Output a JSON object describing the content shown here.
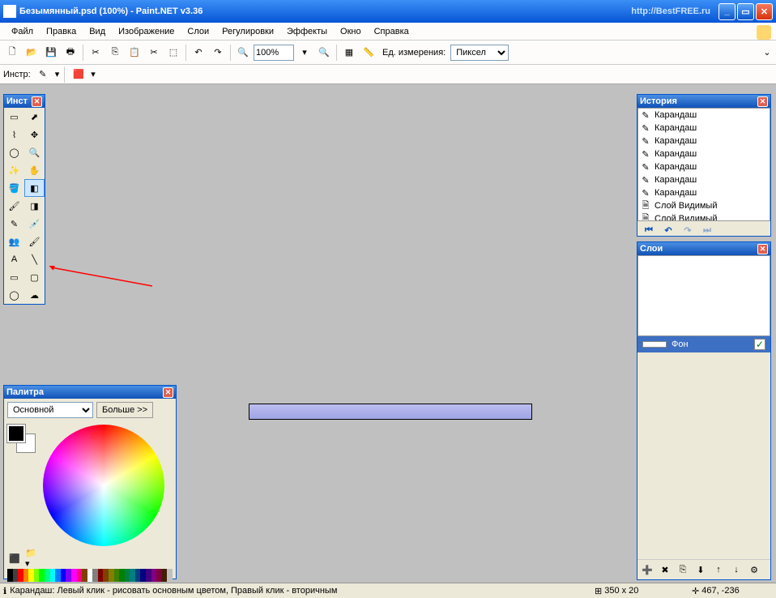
{
  "title": "Безымянный.psd (100%) - Paint.NET v3.36",
  "watermark_url": "http://BestFREE.ru",
  "menu": [
    "Файл",
    "Правка",
    "Вид",
    "Изображение",
    "Слои",
    "Регулировки",
    "Эффекты",
    "Окно",
    "Справка"
  ],
  "toolbar": {
    "zoom": "100%",
    "unit_label": "Ед. измерения:",
    "unit_value": "Пиксел"
  },
  "toolbar2": {
    "label": "Инстр:"
  },
  "panels": {
    "tools": {
      "title": "Инст"
    },
    "history": {
      "title": "История",
      "items": [
        {
          "icon": "pencil",
          "label": "Карандаш"
        },
        {
          "icon": "pencil",
          "label": "Карандаш"
        },
        {
          "icon": "pencil",
          "label": "Карандаш"
        },
        {
          "icon": "pencil",
          "label": "Карандаш"
        },
        {
          "icon": "pencil",
          "label": "Карандаш"
        },
        {
          "icon": "pencil",
          "label": "Карандаш"
        },
        {
          "icon": "pencil",
          "label": "Карандаш"
        },
        {
          "icon": "layer",
          "label": "Слой Видимый"
        },
        {
          "icon": "layer",
          "label": "Слой Видимый"
        }
      ]
    },
    "layers": {
      "title": "Слои",
      "items": [
        {
          "name": "Фон",
          "visible": true
        }
      ]
    },
    "palette": {
      "title": "Палитра",
      "mode": "Основной",
      "more": "Больше >>",
      "primary": "#000000",
      "secondary": "#ffffff",
      "strip": [
        "#000",
        "#404040",
        "#ff0000",
        "#ff8000",
        "#ffff00",
        "#80ff00",
        "#00ff00",
        "#00ff80",
        "#00ffff",
        "#0080ff",
        "#0000ff",
        "#8000ff",
        "#ff00ff",
        "#ff0080",
        "#804000",
        "#fff",
        "#808080",
        "#800000",
        "#804000",
        "#808000",
        "#408000",
        "#008000",
        "#008040",
        "#008080",
        "#004080",
        "#000080",
        "#400080",
        "#800080",
        "#800040",
        "#402000",
        "#c0c0c0"
      ]
    }
  },
  "status": {
    "text": "Карандаш: Левый клик - рисовать основным цветом, Правый клик - вторичным",
    "size": "350 x 20",
    "pos": "467, -236"
  }
}
